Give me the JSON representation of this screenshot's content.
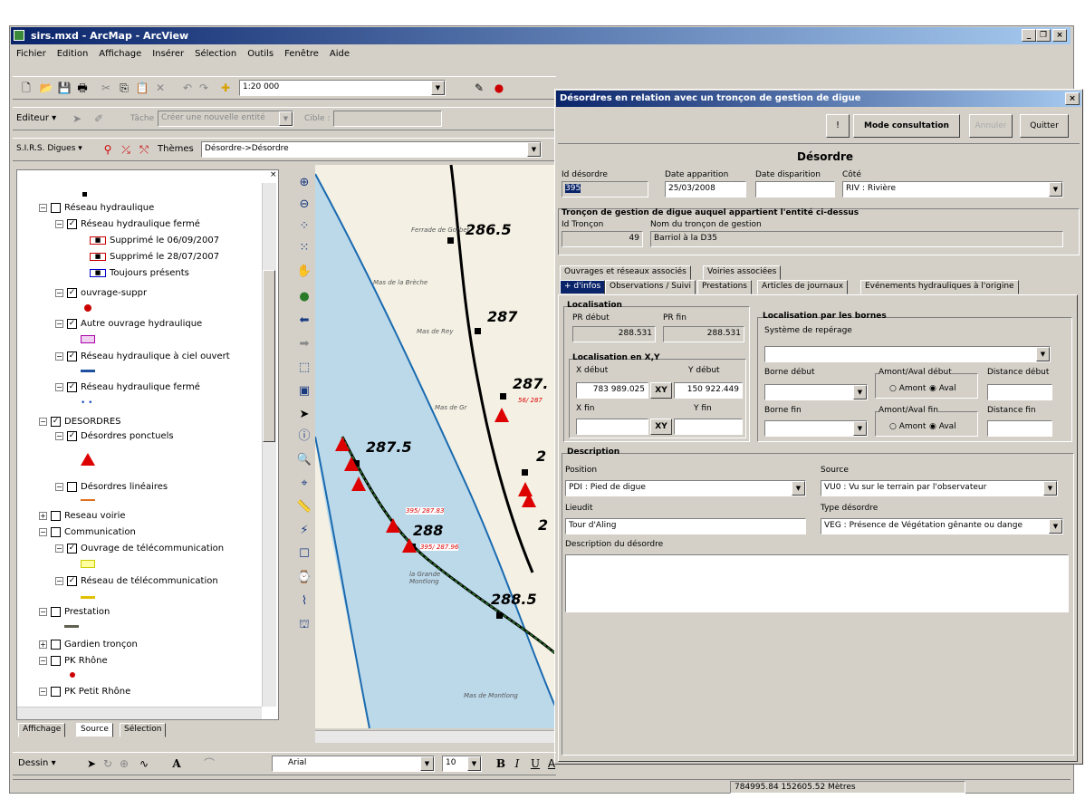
{
  "app": {
    "title": "sirs.mxd - ArcMap - ArcView"
  },
  "menu": [
    "Fichier",
    "Edition",
    "Affichage",
    "Insérer",
    "Sélection",
    "Outils",
    "Fenêtre",
    "Aide"
  ],
  "toolbar": {
    "scale": "1:20 000",
    "editor": "Editeur",
    "task_label": "Tâche :",
    "task_value": "Créer une nouvelle entité",
    "cible_label": "Cible :",
    "sirs_label": "S.I.R.S. Digues",
    "themes_label": "Thèmes",
    "themes_value": "Désordre->Désordre"
  },
  "toc": {
    "items": [
      {
        "label": "Réseau hydraulique",
        "level": 1,
        "checked": false,
        "expand": "-"
      },
      {
        "label": "Réseau hydraulique fermé",
        "level": 2,
        "checked": true,
        "expand": "-"
      },
      {
        "label": "Supprimé le 06/09/2007",
        "level": 3,
        "sym": "red-box"
      },
      {
        "label": "Supprimé le 28/07/2007",
        "level": 3,
        "sym": "red-box"
      },
      {
        "label": "Toujours présents",
        "level": 3,
        "sym": "blue-box"
      },
      {
        "label": "ouvrage-suppr",
        "level": 2,
        "checked": true,
        "expand": "-"
      },
      {
        "label": "Autre ouvrage hydraulique",
        "level": 2,
        "checked": true,
        "expand": "-"
      },
      {
        "label": "Réseau hydraulique à ciel ouvert",
        "level": 2,
        "checked": true,
        "expand": "-"
      },
      {
        "label": "Réseau hydraulique fermé",
        "level": 2,
        "checked": true,
        "expand": "-"
      },
      {
        "label": "DESORDRES",
        "level": 1,
        "checked": true,
        "expand": "-"
      },
      {
        "label": "Désordres ponctuels",
        "level": 2,
        "checked": true,
        "expand": "-"
      },
      {
        "label": "Désordres linéaires",
        "level": 2,
        "checked": false,
        "expand": "-"
      },
      {
        "label": "Reseau voirie",
        "level": 1,
        "checked": false,
        "expand": "+"
      },
      {
        "label": "Communication",
        "level": 1,
        "checked": false,
        "expand": "-"
      },
      {
        "label": "Ouvrage de télécommunication",
        "level": 2,
        "checked": true,
        "expand": "-"
      },
      {
        "label": "Réseau de télécommunication",
        "level": 2,
        "checked": true,
        "expand": "-"
      },
      {
        "label": "Prestation",
        "level": 1,
        "checked": false,
        "expand": "-"
      },
      {
        "label": "Gardien tronçon",
        "level": 1,
        "checked": false,
        "expand": "+"
      },
      {
        "label": "PK Rhône",
        "level": 1,
        "checked": false,
        "expand": "-"
      },
      {
        "label": "PK Petit Rhône",
        "level": 1,
        "checked": false,
        "expand": "-"
      }
    ],
    "tabs": [
      "Affichage",
      "Source",
      "Sélection"
    ]
  },
  "map": {
    "pk": [
      "286.5",
      "287",
      "287.",
      "287.5",
      "2",
      "288",
      "2",
      "288.5"
    ],
    "places": [
      "Mas de la Brèche",
      "Mas de Rey",
      "Mas de Gr",
      "la Grande Montlong",
      "Mas de Montlong",
      "Ferrade de Gorbet"
    ],
    "labels": [
      "395/ 287.83",
      "395/ 287.96",
      "56/ 287"
    ]
  },
  "dialog": {
    "title": "Désordres en relation avec un tronçon de gestion de digue",
    "btn_info": "!",
    "btn_mode": "Mode consultation",
    "btn_annuler": "Annuler",
    "btn_quitter": "Quitter",
    "heading": "Désordre",
    "id_label": "Id désordre",
    "id_value": "395",
    "date_app_label": "Date apparition",
    "date_app_value": "25/03/2008",
    "date_disp_label": "Date disparition",
    "date_disp_value": "",
    "cote_label": "Côté",
    "cote_value": "RIV : Rivière",
    "troncon_heading": "Tronçon de gestion de digue auquel appartient l'entité ci-dessus",
    "id_troncon_label": "Id Tronçon",
    "id_troncon_value": "49",
    "nom_troncon_label": "Nom du tronçon de gestion",
    "nom_troncon_value": "Barriol à la D35",
    "tabs1": [
      "Ouvrages et réseaux associés",
      "Voiries associées"
    ],
    "tabs2": [
      "+ d'infos",
      "Observations / Suivi",
      "Prestations",
      "Articles de journaux",
      "Evénements hydrauliques à l'origine"
    ],
    "loc_heading": "Localisation",
    "pr_debut_label": "PR début",
    "pr_debut_value": "288.531",
    "pr_fin_label": "PR fin",
    "pr_fin_value": "288.531",
    "xy_heading": "Localisation en X,Y",
    "x_debut_label": "X début",
    "x_debut_value": "783 989.025",
    "y_debut_label": "Y début",
    "y_debut_value": "150 922.449",
    "xy_btn": "XY",
    "x_fin_label": "X fin",
    "x_fin_value": "",
    "y_fin_label": "Y fin",
    "y_fin_value": "",
    "bornes_heading": "Localisation par les bornes",
    "systeme_label": "Système de repérage",
    "systeme_value": "",
    "borne_debut_label": "Borne début",
    "borne_fin_label": "Borne fin",
    "amont_debut_label": "Amont/Aval début",
    "amont_fin_label": "Amont/Aval fin",
    "amont": "Amont",
    "aval": "Aval",
    "dist_debut_label": "Distance début",
    "dist_fin_label": "Distance fin",
    "desc_heading": "Description",
    "position_label": "Position",
    "position_value": "PDI : Pied de digue",
    "source_label": "Source",
    "source_value": "VU0 : Vu sur le terrain par l'observateur",
    "lieudit_label": "Lieudit",
    "lieudit_value": "Tour d'Aling",
    "type_label": "Type désordre",
    "type_value": "VEG : Présence de Végétation gênante ou dange",
    "desc_label": "Description du désordre",
    "desc_value": ""
  },
  "draw": {
    "dessin": "Dessin",
    "font": "Arial",
    "size": "10"
  },
  "status": {
    "coords": "784995.84  152605.52 Mètres"
  }
}
